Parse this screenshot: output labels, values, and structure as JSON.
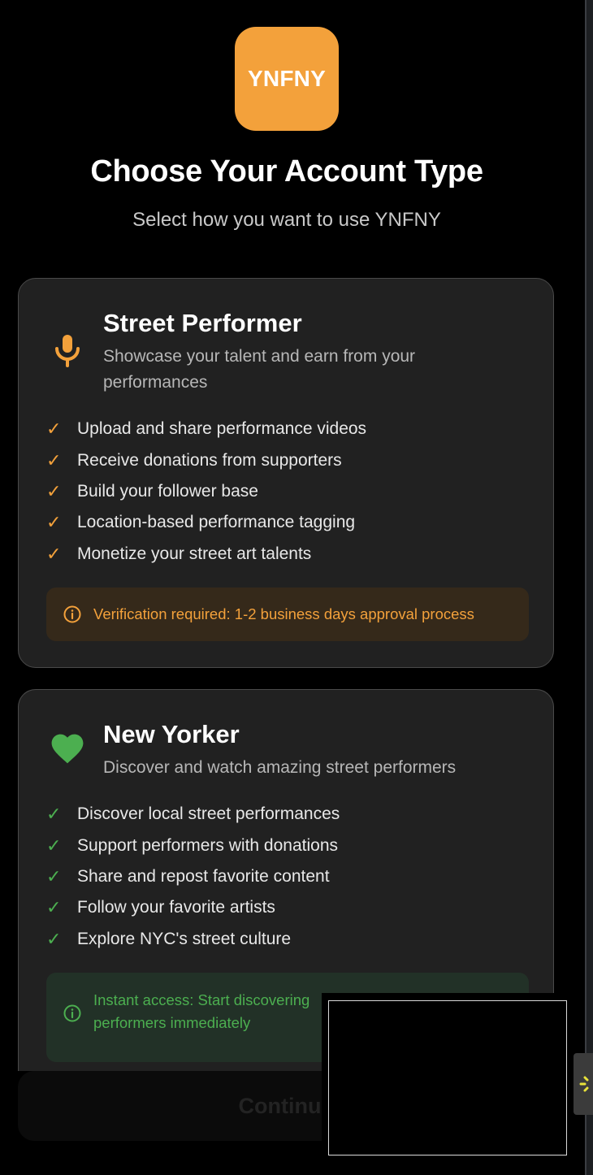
{
  "logo": {
    "text": "YNFNY",
    "color": "#F3A13B"
  },
  "header": {
    "title": "Choose Your Account Type",
    "subtitle": "Select how you want to use YNFNY"
  },
  "cards": [
    {
      "icon": "microphone-icon",
      "title": "Street Performer",
      "description": "Showcase your talent and earn from your performances",
      "features": [
        "Upload and share performance videos",
        "Receive donations from supporters",
        "Build your follower base",
        "Location-based performance tagging",
        "Monetize your street art talents"
      ],
      "note": "Verification required: 1-2 business days approval process",
      "accent": "#F3A13B"
    },
    {
      "icon": "heart-icon",
      "title": "New Yorker",
      "description": "Discover and watch amazing street performers",
      "features": [
        "Discover local street performances",
        "Support performers with donations",
        "Share and repost favorite content",
        "Follow your favorite artists",
        "Explore NYC's street culture"
      ],
      "note": "Instant access: Start discovering performers immediately",
      "accent": "#4CAF50"
    }
  ],
  "continue_button": {
    "label": "Continue"
  },
  "check_glyph": "✓"
}
